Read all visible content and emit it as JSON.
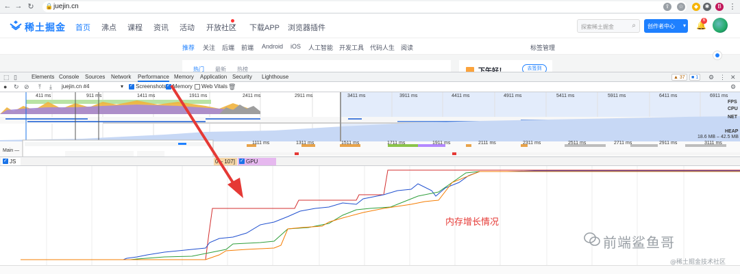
{
  "browser": {
    "url": "juejin.cn"
  },
  "site": {
    "logo_text": "稀土掘金",
    "nav": [
      {
        "label": "首页",
        "active": true
      },
      {
        "label": "沸点"
      },
      {
        "label": "课程"
      },
      {
        "label": "资讯"
      },
      {
        "label": "活动"
      },
      {
        "label": "开放社区"
      },
      {
        "label": "下载APP"
      },
      {
        "label": "浏览器插件"
      }
    ],
    "search_placeholder": "探索稀土掘金",
    "creator_button": "创作者中心",
    "notification_count": "6",
    "sub_nav": [
      {
        "label": "推荐",
        "active": true
      },
      {
        "label": "关注"
      },
      {
        "label": "后端"
      },
      {
        "label": "前端"
      },
      {
        "label": "Android"
      },
      {
        "label": "iOS"
      },
      {
        "label": "人工智能"
      },
      {
        "label": "开发工具"
      },
      {
        "label": "代码人生"
      },
      {
        "label": "阅读"
      }
    ],
    "tag_manage": "标签管理",
    "feed_tabs": [
      {
        "label": "热门",
        "active": true
      },
      {
        "label": "最新"
      },
      {
        "label": "热榜"
      }
    ],
    "greeting": "下午好！",
    "signin_button": "去签到"
  },
  "devtools": {
    "tabs": [
      "Elements",
      "Console",
      "Sources",
      "Network",
      "Performance",
      "Memory",
      "Application",
      "Security",
      "Lighthouse"
    ],
    "active_tab": "Performance",
    "warnings": "37",
    "messages": "1",
    "toolbar": {
      "profile_select": "juejin.cn #4",
      "screenshots_label": "Screenshots",
      "memory_label": "Memory",
      "webvitals_label": "Web Vitals"
    },
    "overview_ticks": [
      "411 ms",
      "911 ms",
      "1411 ms",
      "1911 ms",
      "2411 ms",
      "2911 ms",
      "3411 ms",
      "3911 ms",
      "4411 ms",
      "4911 ms",
      "5411 ms",
      "5911 ms",
      "6411 ms",
      "6911 ms"
    ],
    "lanes": {
      "fps": "FPS",
      "cpu": "CPU",
      "net": "NET",
      "heap": "HEAP"
    },
    "heap_range": "18.6 MB – 42.5 MB",
    "detail_ticks": [
      "1111 ms",
      "1311 ms",
      "1511 ms",
      "1711 ms",
      "1911 ms",
      "2111 ms",
      "2311 ms",
      "2511 ms",
      "2711 ms",
      "2911 ms",
      "3111 ms"
    ],
    "main_label": "Main —",
    "tracks": [
      {
        "label": "JS H",
        "color": "#1a73e8"
      },
      {
        "label": "0 – 107]",
        "color": "#e8a34a"
      },
      {
        "label": "GPU Memory",
        "color": "#c86dd7"
      }
    ]
  },
  "annotation": "内存增长情况",
  "watermark": {
    "main": "前端鲨鱼哥",
    "sub": "@稀土掘金技术社区"
  }
}
